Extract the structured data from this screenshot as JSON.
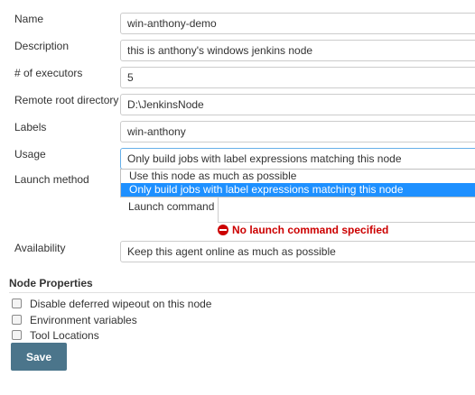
{
  "form": {
    "name": {
      "label": "Name",
      "value": "win-anthony-demo"
    },
    "description": {
      "label": "Description",
      "value": "this is anthony's windows jenkins node"
    },
    "executors": {
      "label": "# of executors",
      "value": "5"
    },
    "remote_root": {
      "label": "Remote root directory",
      "value": "D:\\JenkinsNode"
    },
    "labels": {
      "label": "Labels",
      "value": "win-anthony"
    },
    "usage": {
      "label": "Usage",
      "selected": "Only build jobs with label expressions matching this node",
      "options": [
        "Use this node as much as possible",
        "Only build jobs with label expressions matching this node"
      ]
    },
    "launch_method": {
      "label": "Launch method",
      "launch_command_label": "Launch command",
      "error": "No launch command specified"
    },
    "availability": {
      "label": "Availability",
      "value": "Keep this agent online as much as possible"
    }
  },
  "node_properties": {
    "title": "Node Properties",
    "items": [
      "Disable deferred wipeout on this node",
      "Environment variables",
      "Tool Locations"
    ]
  },
  "save_label": "Save",
  "colors": {
    "accent": "#1e90ff",
    "error": "#cc0000",
    "save": "#4b758b"
  }
}
